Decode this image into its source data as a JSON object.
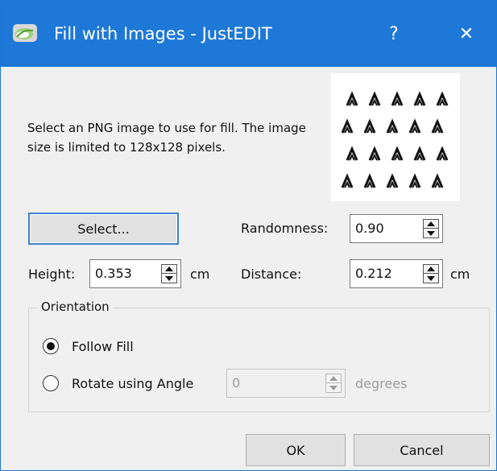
{
  "window": {
    "title": "Fill with Images - JustEDIT",
    "help_glyph": "?",
    "close_glyph": "✕",
    "titlebar_color": "#1e78d7"
  },
  "description": "Select an  PNG image to use for fill. The image size is limited to 128x128 pixels.",
  "select_button": "Select...",
  "randomness": {
    "label": "Randomness:",
    "value": "0.90"
  },
  "height": {
    "label": "Height:",
    "value": "0.353",
    "unit": "cm"
  },
  "distance": {
    "label": "Distance:",
    "value": "0.212",
    "unit": "cm"
  },
  "orientation": {
    "title": "Orientation",
    "options": [
      {
        "label": "Follow Fill",
        "selected": true
      },
      {
        "label": "Rotate using Angle",
        "selected": false
      }
    ],
    "angle": {
      "value": "0",
      "unit": "degrees",
      "enabled": false
    }
  },
  "buttons": {
    "ok": "OK",
    "cancel": "Cancel"
  }
}
